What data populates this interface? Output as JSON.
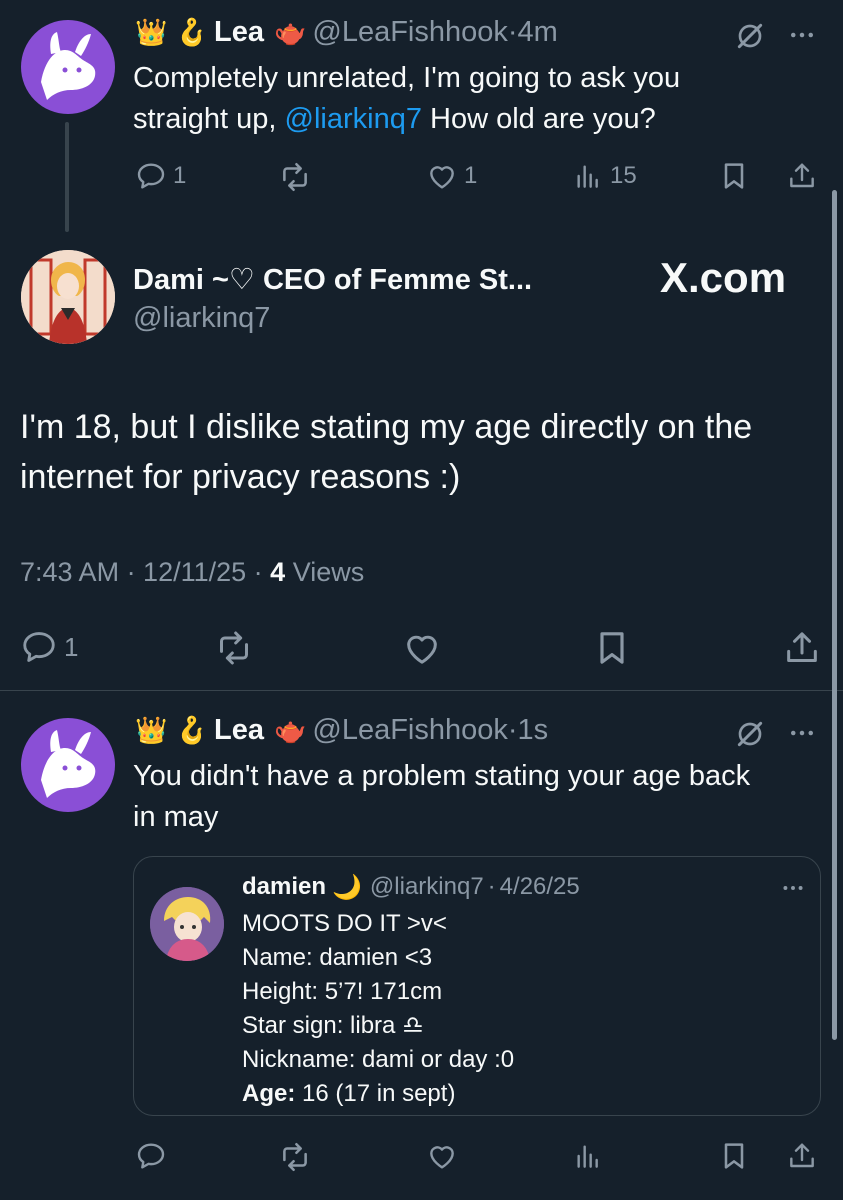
{
  "tweet1": {
    "emojis": "👑 🪝",
    "name": "Lea",
    "name_emoji": "🫖",
    "handle": "@LeaFishhook",
    "time": "4m",
    "text_before": "Completely unrelated, I'm going to ask you straight up, ",
    "mention": "@liarkinq7",
    "text_after": " How old are you?",
    "replies": "1",
    "likes": "1",
    "views": "15"
  },
  "main_tweet": {
    "name": "Dami ~♡ CEO of Femme St...",
    "handle": "@liarkinq7",
    "watermark": "X.com",
    "text": "I'm 18, but I dislike stating my age directly on the internet for privacy reasons :)",
    "time": "7:43 AM · 12/11/25 · ",
    "views_count": "4",
    "views_label": " Views",
    "replies": "1"
  },
  "tweet2": {
    "emojis": "👑 🪝",
    "name": "Lea",
    "name_emoji": "🫖",
    "handle": "@LeaFishhook",
    "time": "1s",
    "text": "You didn't have a problem stating your age back in may"
  },
  "quote": {
    "name": "damien",
    "name_emoji": "🌙",
    "handle": "@liarkinq7",
    "date": "4/26/25",
    "lines": [
      "MOOTS DO IT >v<",
      "Name: damien <3",
      "Height: 5’7! 171cm",
      "Star sign: libra ♎",
      "Nickname: dami or day :0"
    ],
    "age_label": "Age:",
    "age_value": "  16 (17 in sept)"
  },
  "colors": {
    "background": "#15202b",
    "text": "#f7f9f9",
    "muted": "#8b98a5",
    "accent": "#1d9bf0",
    "border": "#38444d"
  },
  "icons": [
    "reply-icon",
    "retweet-icon",
    "like-icon",
    "views-icon",
    "bookmark-icon",
    "share-icon",
    "grok-icon",
    "more-icon"
  ]
}
